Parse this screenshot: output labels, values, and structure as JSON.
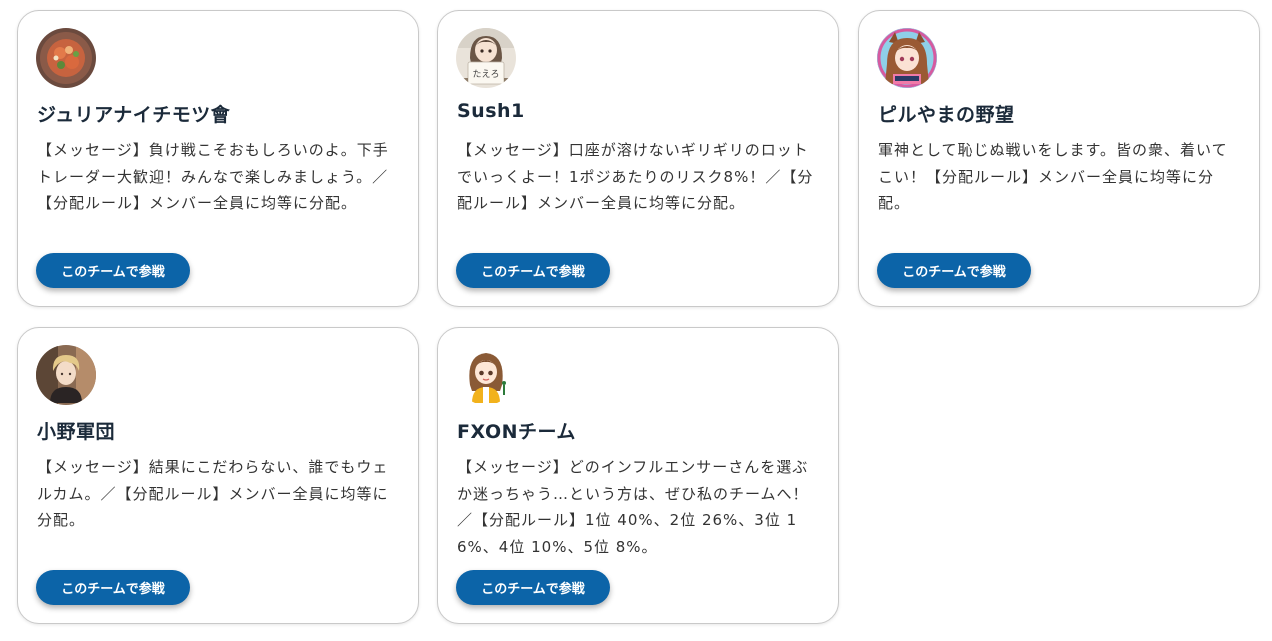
{
  "teams": [
    {
      "name": "ジュリアナイチモツ會",
      "message": "【メッセージ】負け戦こそおもしろいのよ。下手トレーダー大歓迎！みんなで楽しみましょう。／【分配ルール】メンバー全員に均等に分配。",
      "join_label": "このチームで参戦",
      "avatar_icon": "food-dish-avatar-icon"
    },
    {
      "name": "Sush1",
      "message": "【メッセージ】口座が溶けないギリギリのロットでいっくよー！1ポジあたりのリスク8%！／【分配ルール】メンバー全員に均等に分配。",
      "join_label": "このチームで参戦",
      "avatar_icon": "girl-holding-sign-avatar-icon",
      "avatar_sign_text": "たえろ"
    },
    {
      "name": "ピルやまの野望",
      "message": "軍神として恥じぬ戦いをします。皆の衆、着いてこい！【分配ルール】メンバー全員に均等に分配。",
      "join_label": "このチームで参戦",
      "avatar_icon": "anime-fox-girl-avatar-icon"
    },
    {
      "name": "小野軍団",
      "message": "【メッセージ】結果にこだわらない、誰でもウェルカム。／【分配ルール】メンバー全員に均等に分配。",
      "join_label": "このチームで参戦",
      "avatar_icon": "blond-man-avatar-icon"
    },
    {
      "name": "FXONチーム",
      "message": "【メッセージ】どのインフルエンサーさんを選ぶか迷っちゃう…という方は、ぜひ私のチームへ！／【分配ルール】1位 40%、2位 26%、3位 16%、4位 10%、5位 8%。",
      "join_label": "このチームで参戦",
      "avatar_icon": "illustrated-girl-avatar-icon"
    }
  ],
  "colors": {
    "button": "#0c64a8",
    "title": "#1b2a3a",
    "text": "#333333",
    "card_border": "#c9c9c9"
  }
}
